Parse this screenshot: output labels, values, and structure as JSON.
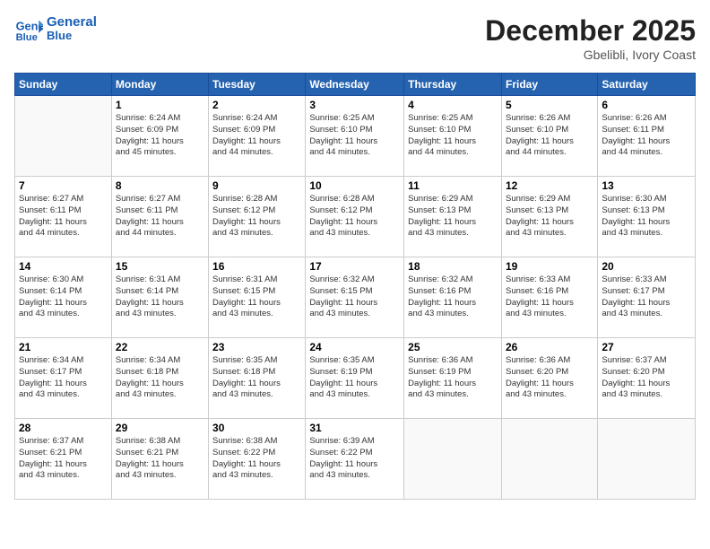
{
  "header": {
    "logo_line1": "General",
    "logo_line2": "Blue",
    "month_year": "December 2025",
    "location": "Gbelibli, Ivory Coast"
  },
  "days_of_week": [
    "Sunday",
    "Monday",
    "Tuesday",
    "Wednesday",
    "Thursday",
    "Friday",
    "Saturday"
  ],
  "weeks": [
    [
      {
        "num": "",
        "info": ""
      },
      {
        "num": "1",
        "info": "Sunrise: 6:24 AM\nSunset: 6:09 PM\nDaylight: 11 hours\nand 45 minutes."
      },
      {
        "num": "2",
        "info": "Sunrise: 6:24 AM\nSunset: 6:09 PM\nDaylight: 11 hours\nand 44 minutes."
      },
      {
        "num": "3",
        "info": "Sunrise: 6:25 AM\nSunset: 6:10 PM\nDaylight: 11 hours\nand 44 minutes."
      },
      {
        "num": "4",
        "info": "Sunrise: 6:25 AM\nSunset: 6:10 PM\nDaylight: 11 hours\nand 44 minutes."
      },
      {
        "num": "5",
        "info": "Sunrise: 6:26 AM\nSunset: 6:10 PM\nDaylight: 11 hours\nand 44 minutes."
      },
      {
        "num": "6",
        "info": "Sunrise: 6:26 AM\nSunset: 6:11 PM\nDaylight: 11 hours\nand 44 minutes."
      }
    ],
    [
      {
        "num": "7",
        "info": "Sunrise: 6:27 AM\nSunset: 6:11 PM\nDaylight: 11 hours\nand 44 minutes."
      },
      {
        "num": "8",
        "info": "Sunrise: 6:27 AM\nSunset: 6:11 PM\nDaylight: 11 hours\nand 44 minutes."
      },
      {
        "num": "9",
        "info": "Sunrise: 6:28 AM\nSunset: 6:12 PM\nDaylight: 11 hours\nand 43 minutes."
      },
      {
        "num": "10",
        "info": "Sunrise: 6:28 AM\nSunset: 6:12 PM\nDaylight: 11 hours\nand 43 minutes."
      },
      {
        "num": "11",
        "info": "Sunrise: 6:29 AM\nSunset: 6:13 PM\nDaylight: 11 hours\nand 43 minutes."
      },
      {
        "num": "12",
        "info": "Sunrise: 6:29 AM\nSunset: 6:13 PM\nDaylight: 11 hours\nand 43 minutes."
      },
      {
        "num": "13",
        "info": "Sunrise: 6:30 AM\nSunset: 6:13 PM\nDaylight: 11 hours\nand 43 minutes."
      }
    ],
    [
      {
        "num": "14",
        "info": "Sunrise: 6:30 AM\nSunset: 6:14 PM\nDaylight: 11 hours\nand 43 minutes."
      },
      {
        "num": "15",
        "info": "Sunrise: 6:31 AM\nSunset: 6:14 PM\nDaylight: 11 hours\nand 43 minutes."
      },
      {
        "num": "16",
        "info": "Sunrise: 6:31 AM\nSunset: 6:15 PM\nDaylight: 11 hours\nand 43 minutes."
      },
      {
        "num": "17",
        "info": "Sunrise: 6:32 AM\nSunset: 6:15 PM\nDaylight: 11 hours\nand 43 minutes."
      },
      {
        "num": "18",
        "info": "Sunrise: 6:32 AM\nSunset: 6:16 PM\nDaylight: 11 hours\nand 43 minutes."
      },
      {
        "num": "19",
        "info": "Sunrise: 6:33 AM\nSunset: 6:16 PM\nDaylight: 11 hours\nand 43 minutes."
      },
      {
        "num": "20",
        "info": "Sunrise: 6:33 AM\nSunset: 6:17 PM\nDaylight: 11 hours\nand 43 minutes."
      }
    ],
    [
      {
        "num": "21",
        "info": "Sunrise: 6:34 AM\nSunset: 6:17 PM\nDaylight: 11 hours\nand 43 minutes."
      },
      {
        "num": "22",
        "info": "Sunrise: 6:34 AM\nSunset: 6:18 PM\nDaylight: 11 hours\nand 43 minutes."
      },
      {
        "num": "23",
        "info": "Sunrise: 6:35 AM\nSunset: 6:18 PM\nDaylight: 11 hours\nand 43 minutes."
      },
      {
        "num": "24",
        "info": "Sunrise: 6:35 AM\nSunset: 6:19 PM\nDaylight: 11 hours\nand 43 minutes."
      },
      {
        "num": "25",
        "info": "Sunrise: 6:36 AM\nSunset: 6:19 PM\nDaylight: 11 hours\nand 43 minutes."
      },
      {
        "num": "26",
        "info": "Sunrise: 6:36 AM\nSunset: 6:20 PM\nDaylight: 11 hours\nand 43 minutes."
      },
      {
        "num": "27",
        "info": "Sunrise: 6:37 AM\nSunset: 6:20 PM\nDaylight: 11 hours\nand 43 minutes."
      }
    ],
    [
      {
        "num": "28",
        "info": "Sunrise: 6:37 AM\nSunset: 6:21 PM\nDaylight: 11 hours\nand 43 minutes."
      },
      {
        "num": "29",
        "info": "Sunrise: 6:38 AM\nSunset: 6:21 PM\nDaylight: 11 hours\nand 43 minutes."
      },
      {
        "num": "30",
        "info": "Sunrise: 6:38 AM\nSunset: 6:22 PM\nDaylight: 11 hours\nand 43 minutes."
      },
      {
        "num": "31",
        "info": "Sunrise: 6:39 AM\nSunset: 6:22 PM\nDaylight: 11 hours\nand 43 minutes."
      },
      {
        "num": "",
        "info": ""
      },
      {
        "num": "",
        "info": ""
      },
      {
        "num": "",
        "info": ""
      }
    ]
  ]
}
